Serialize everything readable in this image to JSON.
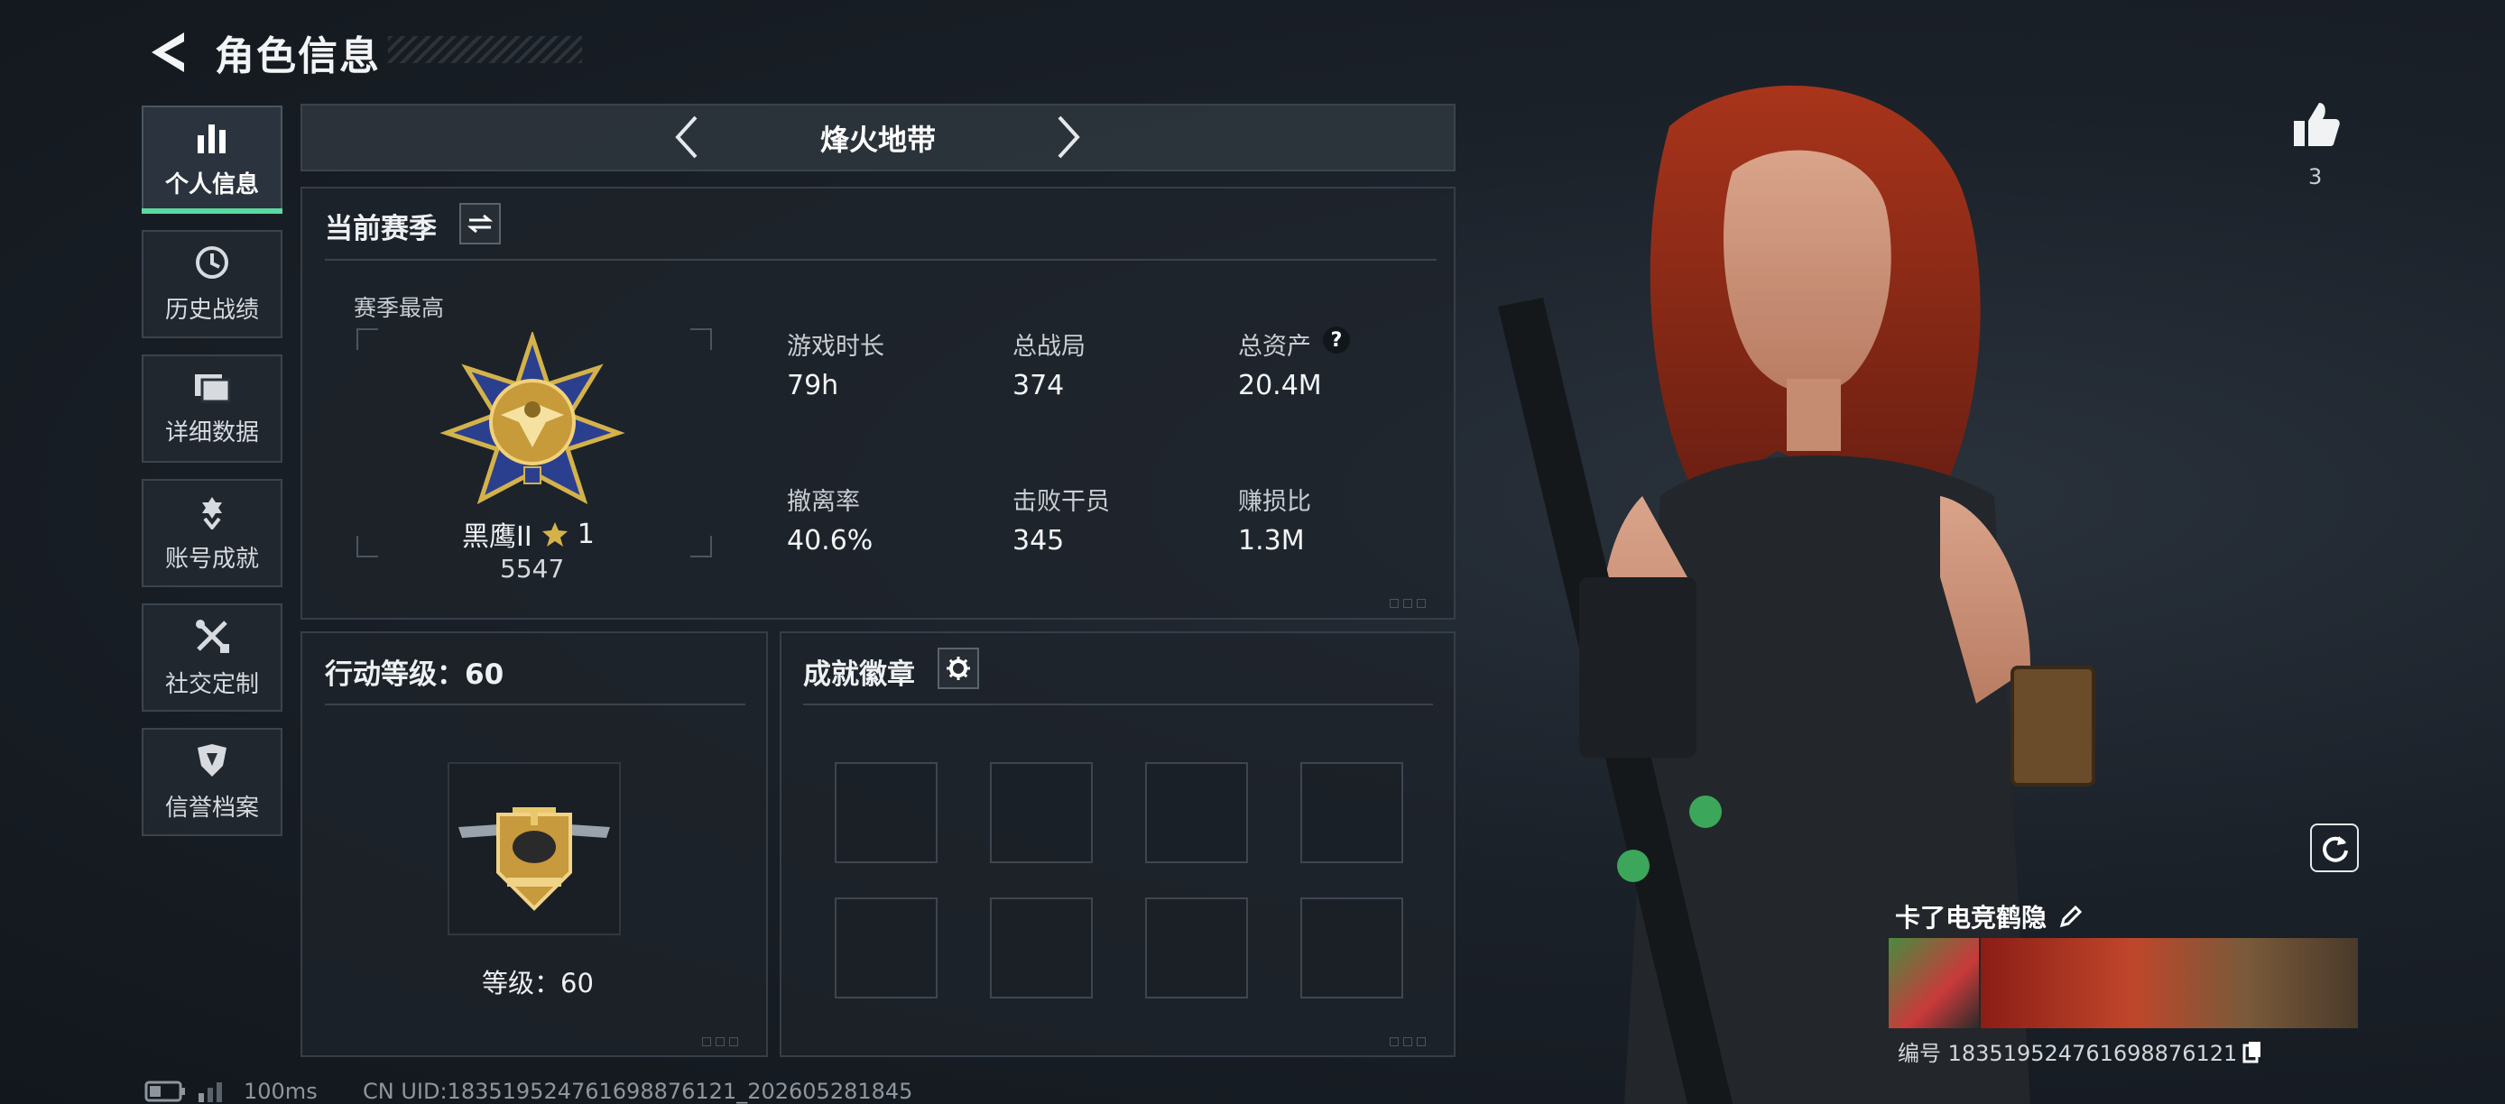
{
  "header": {
    "title": "角色信息"
  },
  "sidebar": {
    "items": [
      {
        "label": "个人信息",
        "icon": "bar-chart-icon",
        "active": true
      },
      {
        "label": "历史战绩",
        "icon": "history-clock-icon"
      },
      {
        "label": "详细数据",
        "icon": "folder-icon"
      },
      {
        "label": "账号成就",
        "icon": "achievement-icon"
      },
      {
        "label": "社交定制",
        "icon": "tools-icon"
      },
      {
        "label": "信誉档案",
        "icon": "shield-icon"
      }
    ]
  },
  "mode": {
    "label": "烽火地带"
  },
  "season": {
    "title": "当前赛季",
    "best_label": "赛季最高",
    "rank_name": "黑鹰II",
    "rank_stars": "1",
    "rank_score": "5547",
    "stats": [
      {
        "label": "游戏时长",
        "value": "79h"
      },
      {
        "label": "总战局",
        "value": "374"
      },
      {
        "label": "总资产",
        "value": "20.4M",
        "help": "?"
      },
      {
        "label": "撤离率",
        "value": "40.6%"
      },
      {
        "label": "击败干员",
        "value": "345"
      },
      {
        "label": "赚损比",
        "value": "1.3M"
      }
    ]
  },
  "action_level": {
    "title": "行动等级：60",
    "level_text": "等级：60"
  },
  "badges": {
    "title": "成就徽章",
    "slots": 8
  },
  "profile": {
    "likes": "3",
    "name": "卡了电竞鹤隐",
    "id_text": "编号 1835195247616988761​21"
  },
  "footer": {
    "ping": "100ms",
    "uid": "CN UID:183519524761698876121_202605281845"
  },
  "colors": {
    "accent": "#5ad9a2",
    "gold": "#d4b24a"
  }
}
